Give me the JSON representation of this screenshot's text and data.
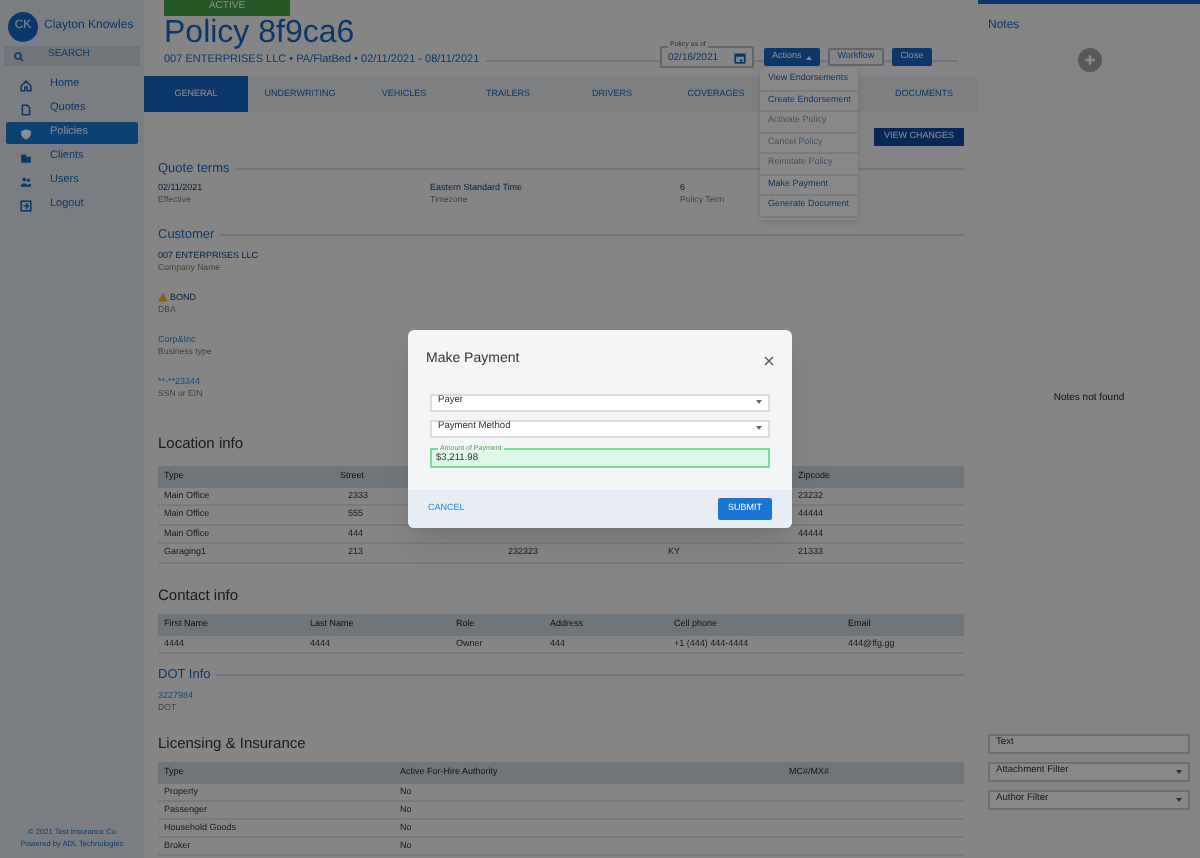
{
  "sidebar": {
    "user": {
      "initials": "CK",
      "name": "Clayton Knowles"
    },
    "search": {
      "placeholder": "SEARCH"
    },
    "items": [
      {
        "label": "Home",
        "selected": false
      },
      {
        "label": "Quotes",
        "selected": false
      },
      {
        "label": "Policies",
        "selected": true
      },
      {
        "label": "Clients",
        "selected": false
      },
      {
        "label": "Users",
        "selected": false
      },
      {
        "label": "Logout",
        "selected": false
      }
    ],
    "footer": [
      "© 2021 Test Insurance Co",
      "Powered by ADL Technologies"
    ]
  },
  "policy": {
    "status": "ACTIVE",
    "title": "Policy 8f9ca6",
    "subtitle": "007 ENTERPRISES LLC • PA/FlatBed • 02/11/2021 - 08/11/2021",
    "as_of": {
      "label": "Policy as of",
      "value": "02/16/2021"
    }
  },
  "buttons": [
    {
      "label": "Actions",
      "kind": "menu"
    },
    {
      "label": "Workflow",
      "kind": "outline"
    },
    {
      "label": "Close",
      "kind": "primary"
    }
  ],
  "actions_menu": [
    {
      "label": "View Endorsements",
      "disabled": false
    },
    {
      "label": "Create Endorsement",
      "disabled": false
    },
    {
      "label": "Activate Policy",
      "disabled": true
    },
    {
      "label": "Cancel Policy",
      "disabled": true
    },
    {
      "label": "Reinstate Policy",
      "disabled": true
    },
    {
      "label": "Make Payment",
      "disabled": false
    },
    {
      "label": "Generate Document",
      "disabled": false
    }
  ],
  "tabs": [
    {
      "label": "GENERAL",
      "selected": true
    },
    {
      "label": "UNDERWRITING",
      "selected": false
    },
    {
      "label": "VEHICLES",
      "selected": false
    },
    {
      "label": "TRAILERS",
      "selected": false
    },
    {
      "label": "DRIVERS",
      "selected": false
    },
    {
      "label": "COVERAGES",
      "selected": false
    },
    {
      "label": "DOCUMENTS",
      "selected": false
    }
  ],
  "view_changes": "VIEW CHANGES",
  "sections": [
    {
      "kind": "row",
      "title": "Quote terms",
      "fields": [
        {
          "value": "02/11/2021",
          "label": "Effective"
        },
        {
          "value": "Eastern Standard Time",
          "label": "Timezone"
        },
        {
          "value": "6",
          "label": "Policy Term"
        }
      ]
    },
    {
      "kind": "stack",
      "title": "Customer",
      "fields": [
        {
          "value": "007 ENTERPRISES LLC",
          "label": "Company Name",
          "link": false,
          "warning": false
        },
        {
          "value": "BOND",
          "label": "DBA",
          "link": false,
          "warning": true
        },
        {
          "value": "Corp&Inc",
          "label": "Business type",
          "link": true,
          "warning": false
        },
        {
          "value": "**-**23344",
          "label": "SSN or EIN",
          "link": true,
          "warning": false
        }
      ]
    },
    {
      "kind": "table",
      "title": "Location info",
      "columns": [
        "Type",
        "Street",
        null,
        null,
        "Zipcode"
      ],
      "rows": [
        [
          "Main Office",
          "2333",
          null,
          null,
          "23232"
        ],
        [
          "Main Office",
          "555",
          null,
          null,
          "44444"
        ],
        [
          "Main Office",
          "444",
          null,
          null,
          "44444"
        ],
        [
          "Garaging1",
          "213",
          "232323",
          "KY",
          "21333"
        ]
      ]
    },
    {
      "kind": "table",
      "title": "Contact info",
      "columns": [
        "First Name",
        "Last Name",
        "Role",
        "Address",
        "Cell phone",
        "Email"
      ],
      "rows": [
        [
          "4444",
          "4444",
          "Owner",
          "444",
          "+1 (444) 444-4444",
          "444@ffg.gg"
        ]
      ]
    },
    {
      "kind": "stack",
      "title": "DOT Info",
      "fields": [
        {
          "value": "3227984",
          "label": "DOT",
          "link": true,
          "warning": false
        }
      ]
    },
    {
      "kind": "table",
      "title": "Licensing & Insurance",
      "columns": [
        "Type",
        "Active For-Hire Authority",
        "MC#/MX#"
      ],
      "rows": [
        [
          "Property",
          "No",
          null
        ],
        [
          "Passenger",
          "No",
          null
        ],
        [
          "Household Goods",
          "No",
          null
        ],
        [
          "Broker",
          "No",
          null
        ]
      ]
    }
  ],
  "notes": {
    "title": "Notes",
    "empty_text": "Notes not found",
    "filters": [
      {
        "kind": "text",
        "placeholder": "Text"
      },
      {
        "kind": "select",
        "placeholder": "Attachment Filter"
      },
      {
        "kind": "select",
        "placeholder": "Author Filter"
      }
    ]
  },
  "modal": {
    "title": "Make Payment",
    "fields": [
      {
        "kind": "select",
        "placeholder": "Payer"
      },
      {
        "kind": "select",
        "placeholder": "Payment Method"
      },
      {
        "kind": "text",
        "label": "Amount of Payment",
        "value": "$3,211.98"
      }
    ],
    "cancel": "CANCEL",
    "submit": "SUBMIT"
  }
}
